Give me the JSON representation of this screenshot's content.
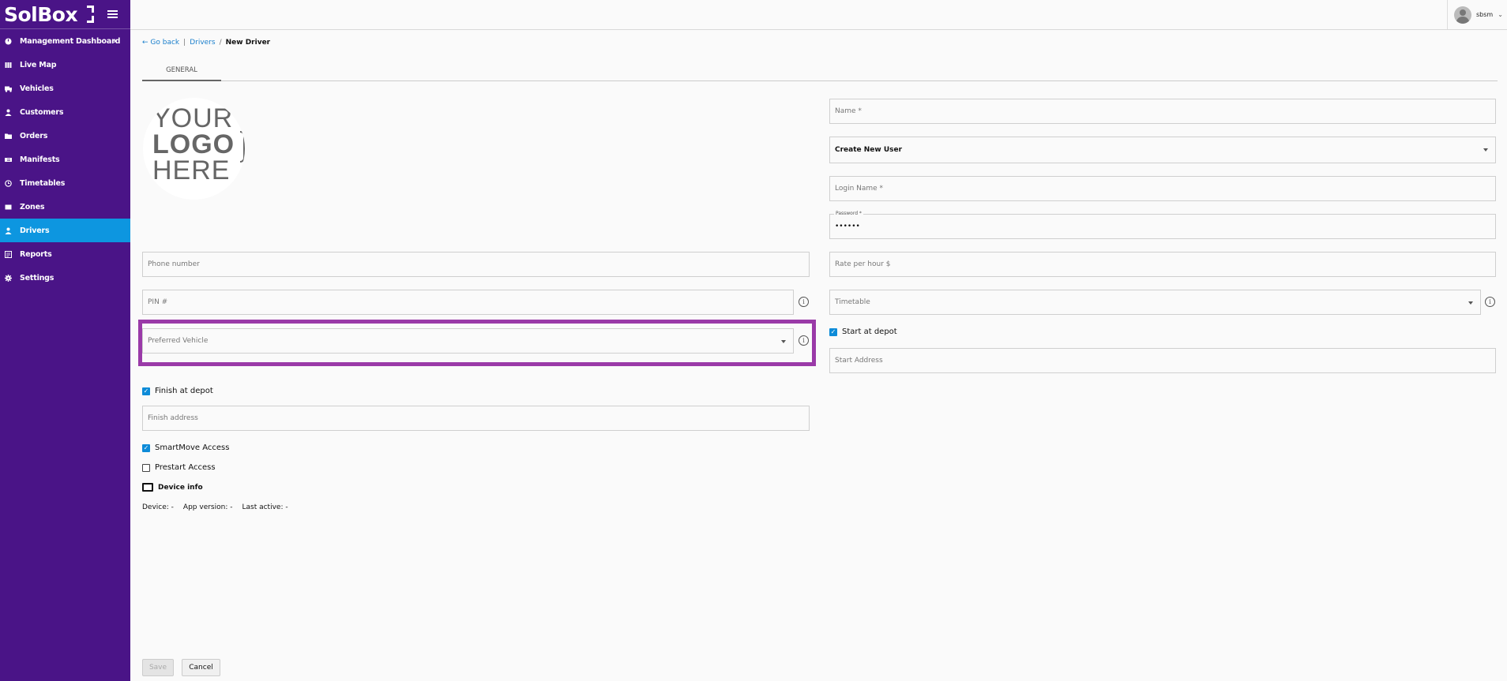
{
  "app": {
    "logo_text": "SolBox"
  },
  "sidebar": {
    "items": [
      {
        "label": "Management Dashboard",
        "icon": "dashboard-icon"
      },
      {
        "label": "Live Map",
        "icon": "map-icon"
      },
      {
        "label": "Vehicles",
        "icon": "truck-icon"
      },
      {
        "label": "Customers",
        "icon": "person-icon"
      },
      {
        "label": "Orders",
        "icon": "folder-icon"
      },
      {
        "label": "Manifests",
        "icon": "manifest-icon"
      },
      {
        "label": "Timetables",
        "icon": "clock-icon"
      },
      {
        "label": "Zones",
        "icon": "zone-icon"
      },
      {
        "label": "Drivers",
        "icon": "driver-icon",
        "active": true
      },
      {
        "label": "Reports",
        "icon": "report-icon"
      },
      {
        "label": "Settings",
        "icon": "gear-icon"
      }
    ],
    "accent": "#4a1487",
    "active_color": "#0d96e0"
  },
  "topbar": {
    "username": "sbsm"
  },
  "breadcrumb": {
    "back": "Go back",
    "sep1": "|",
    "parent": "Drivers",
    "sep2": "/",
    "current": "New Driver"
  },
  "tabs": {
    "general": "GENERAL"
  },
  "logo_placeholder": {
    "line1": "YOUR",
    "line2": "LOGO",
    "line3": "HERE"
  },
  "form": {
    "name_placeholder": "Name *",
    "user_select_value": "Create New User",
    "login_name_placeholder": "Login Name *",
    "password_label": "Password *",
    "password_value": "••••••",
    "phone_placeholder": "Phone number",
    "rate_placeholder": "Rate per hour $",
    "pin_placeholder": "PIN #",
    "timetable_placeholder": "Timetable",
    "preferred_vehicle_placeholder": "Preferred Vehicle",
    "start_at_depot_label": "Start at depot",
    "start_at_depot_checked": true,
    "start_address_placeholder": "Start Address",
    "finish_at_depot_label": "Finish at depot",
    "finish_at_depot_checked": true,
    "finish_address_placeholder": "Finish address",
    "smartmove_label": "SmartMove Access",
    "smartmove_checked": true,
    "prestart_label": "Prestart Access",
    "prestart_checked": false,
    "device_info_label": "Device info",
    "info_symbol": "i"
  },
  "device": {
    "device": "Device: -",
    "app_version": "App version: -",
    "last_active": "Last active: -"
  },
  "buttons": {
    "save": "Save",
    "cancel": "Cancel"
  },
  "highlight_color": "#9a3aa8"
}
